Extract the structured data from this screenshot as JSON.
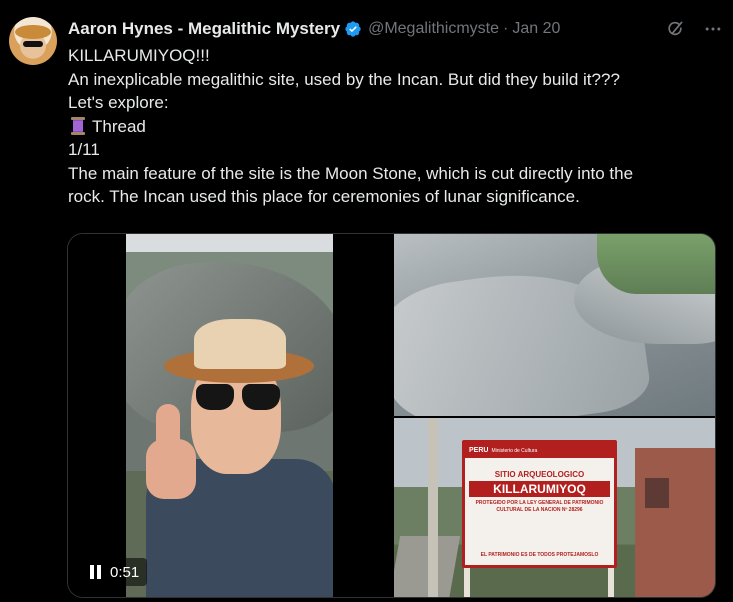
{
  "tweet": {
    "author_name": "Aaron Hynes - Megalithic Mystery",
    "handle": "@Megalithicmyste",
    "separator": "·",
    "date": "Jan 20",
    "verified": true,
    "lines": [
      "KILLARUMIYOQ!!!",
      "An inexplicable megalithic site, used by the Incan. But did they build it???",
      "Let's explore:",
      "Thread",
      "1/11",
      "The main feature of the site is the Moon Stone, which is cut directly into the",
      "rock. The Incan used this place for ceremonies of lunar significance."
    ],
    "thread_icon": "spool-of-thread-emoji"
  },
  "header_actions": {
    "grok_icon": "grok-icon",
    "more_icon": "more-dots-icon"
  },
  "media": {
    "video": {
      "state": "playing",
      "control_icon": "pause-icon",
      "timestamp": "0:51"
    },
    "sign": {
      "country": "PERU",
      "ministry": "Ministerio de Cultura",
      "heading": "SITIO ARQUEOLOGICO",
      "site_name": "KILLARUMIYOQ",
      "protection_line1": "PROTEGIDO POR LA LEY GENERAL DE PATRIMONIO",
      "protection_line2": "CULTURAL DE LA NACION Nº 28296",
      "footer": "EL PATRIMONIO ES DE TODOS PROTEJAMOSLO"
    }
  },
  "colors": {
    "background": "#000000",
    "text": "#e7e9ea",
    "secondary": "#71767b",
    "verified": "#1d9bf0",
    "sign_red": "#b21f1f"
  }
}
